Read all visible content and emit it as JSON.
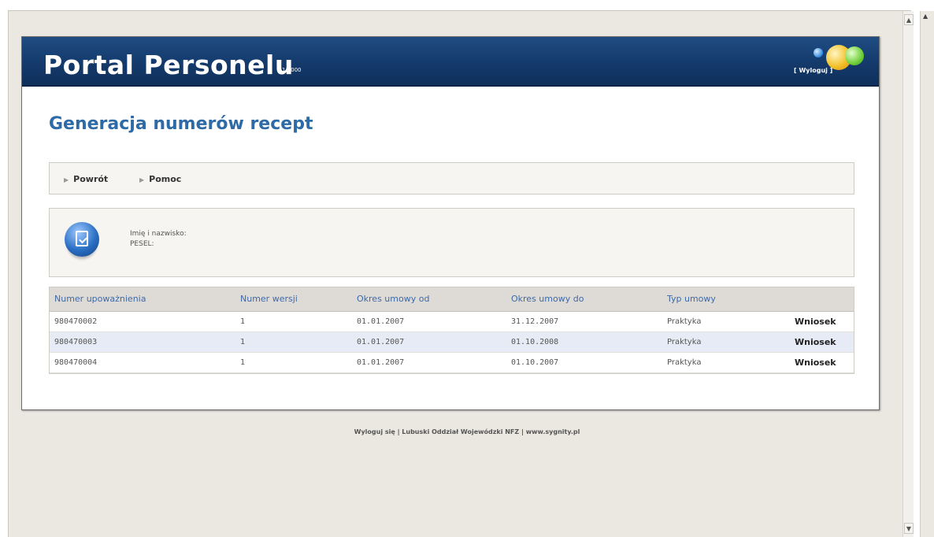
{
  "header": {
    "title": "Portal Personelu",
    "version": "1.0000",
    "logout_link": "[ Wyloguj ]"
  },
  "page": {
    "title": "Generacja numerów recept"
  },
  "nav": {
    "back": "Powrót",
    "help": "Pomoc"
  },
  "info": {
    "name_label": "Imię i nazwisko:",
    "pesel_label": "PESEL:"
  },
  "table": {
    "headers": [
      "Numer upoważnienia",
      "Numer wersji",
      "Okres umowy od",
      "Okres umowy do",
      "Typ umowy",
      ""
    ],
    "rows": [
      [
        "980470002",
        "1",
        "01.01.2007",
        "31.12.2007",
        "Praktyka",
        "Wniosek"
      ],
      [
        "980470003",
        "1",
        "01.01.2007",
        "01.10.2008",
        "Praktyka",
        "Wniosek"
      ],
      [
        "980470004",
        "1",
        "01.01.2007",
        "01.10.2007",
        "Praktyka",
        "Wniosek"
      ]
    ]
  },
  "footer": {
    "logout": "Wyloguj się",
    "sep1": " | ",
    "org": "Lubuski Oddział Wojewódzki NFZ",
    "sep2": " | ",
    "site": "www.sygnity.pl"
  },
  "colors": {
    "header_bg": "#143a6b",
    "title_blue": "#2e6aa6",
    "table_header_text": "#3d6aa8",
    "row_alt_bg": "#e6ebf6"
  }
}
